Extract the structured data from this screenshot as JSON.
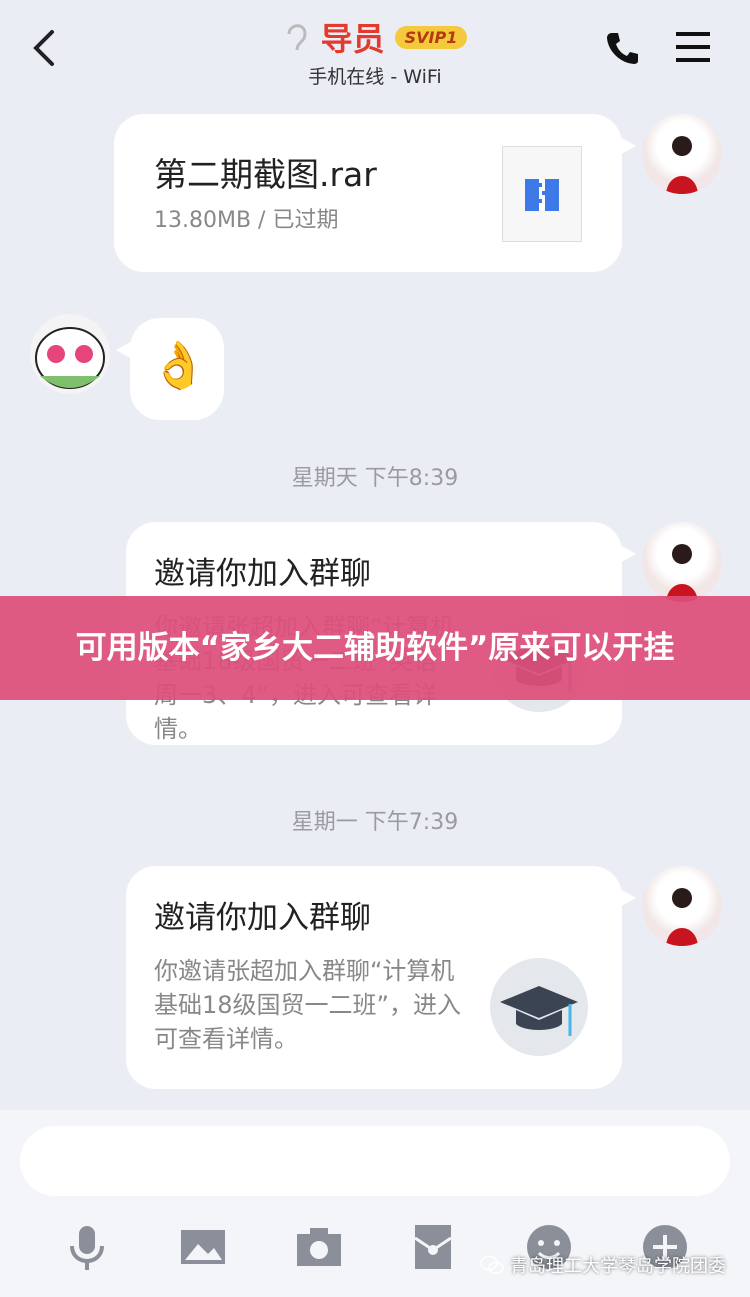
{
  "header": {
    "title": "导员",
    "badge": "SVIP1",
    "status": "手机在线 - WiFi"
  },
  "messages": [
    {
      "type": "file",
      "name": "第二期截图.rar",
      "meta": "13.80MB / 已过期"
    },
    {
      "type": "emoji",
      "content": "👌"
    }
  ],
  "timestamps": [
    "星期天 下午8:39",
    "星期一 下午7:39"
  ],
  "invites": [
    {
      "title": "邀请你加入群聊",
      "body": "你邀请张超加入群聊“计算机基础18级国贸一二班”英语 周一3、4”，进入可查看详情。"
    },
    {
      "title": "邀请你加入群聊",
      "body": "你邀请张超加入群聊“计算机基础18级国贸一二班”，进入可查看详情。"
    }
  ],
  "banner": {
    "text": "可用版本“家乡大二辅助软件”原来可以开挂"
  },
  "watermark": {
    "text": "青岛理工大学琴岛学院团委"
  },
  "colors": {
    "accent": "#e23b2e",
    "banner": "#de4f7a",
    "bg": "#ebedf5"
  },
  "icons": [
    "back-icon",
    "ear-icon",
    "phone-icon",
    "menu-icon",
    "rar-file-icon",
    "graduation-cap-icon",
    "mic-icon",
    "image-icon",
    "camera-icon",
    "red-packet-icon",
    "emoji-icon",
    "plus-icon"
  ]
}
